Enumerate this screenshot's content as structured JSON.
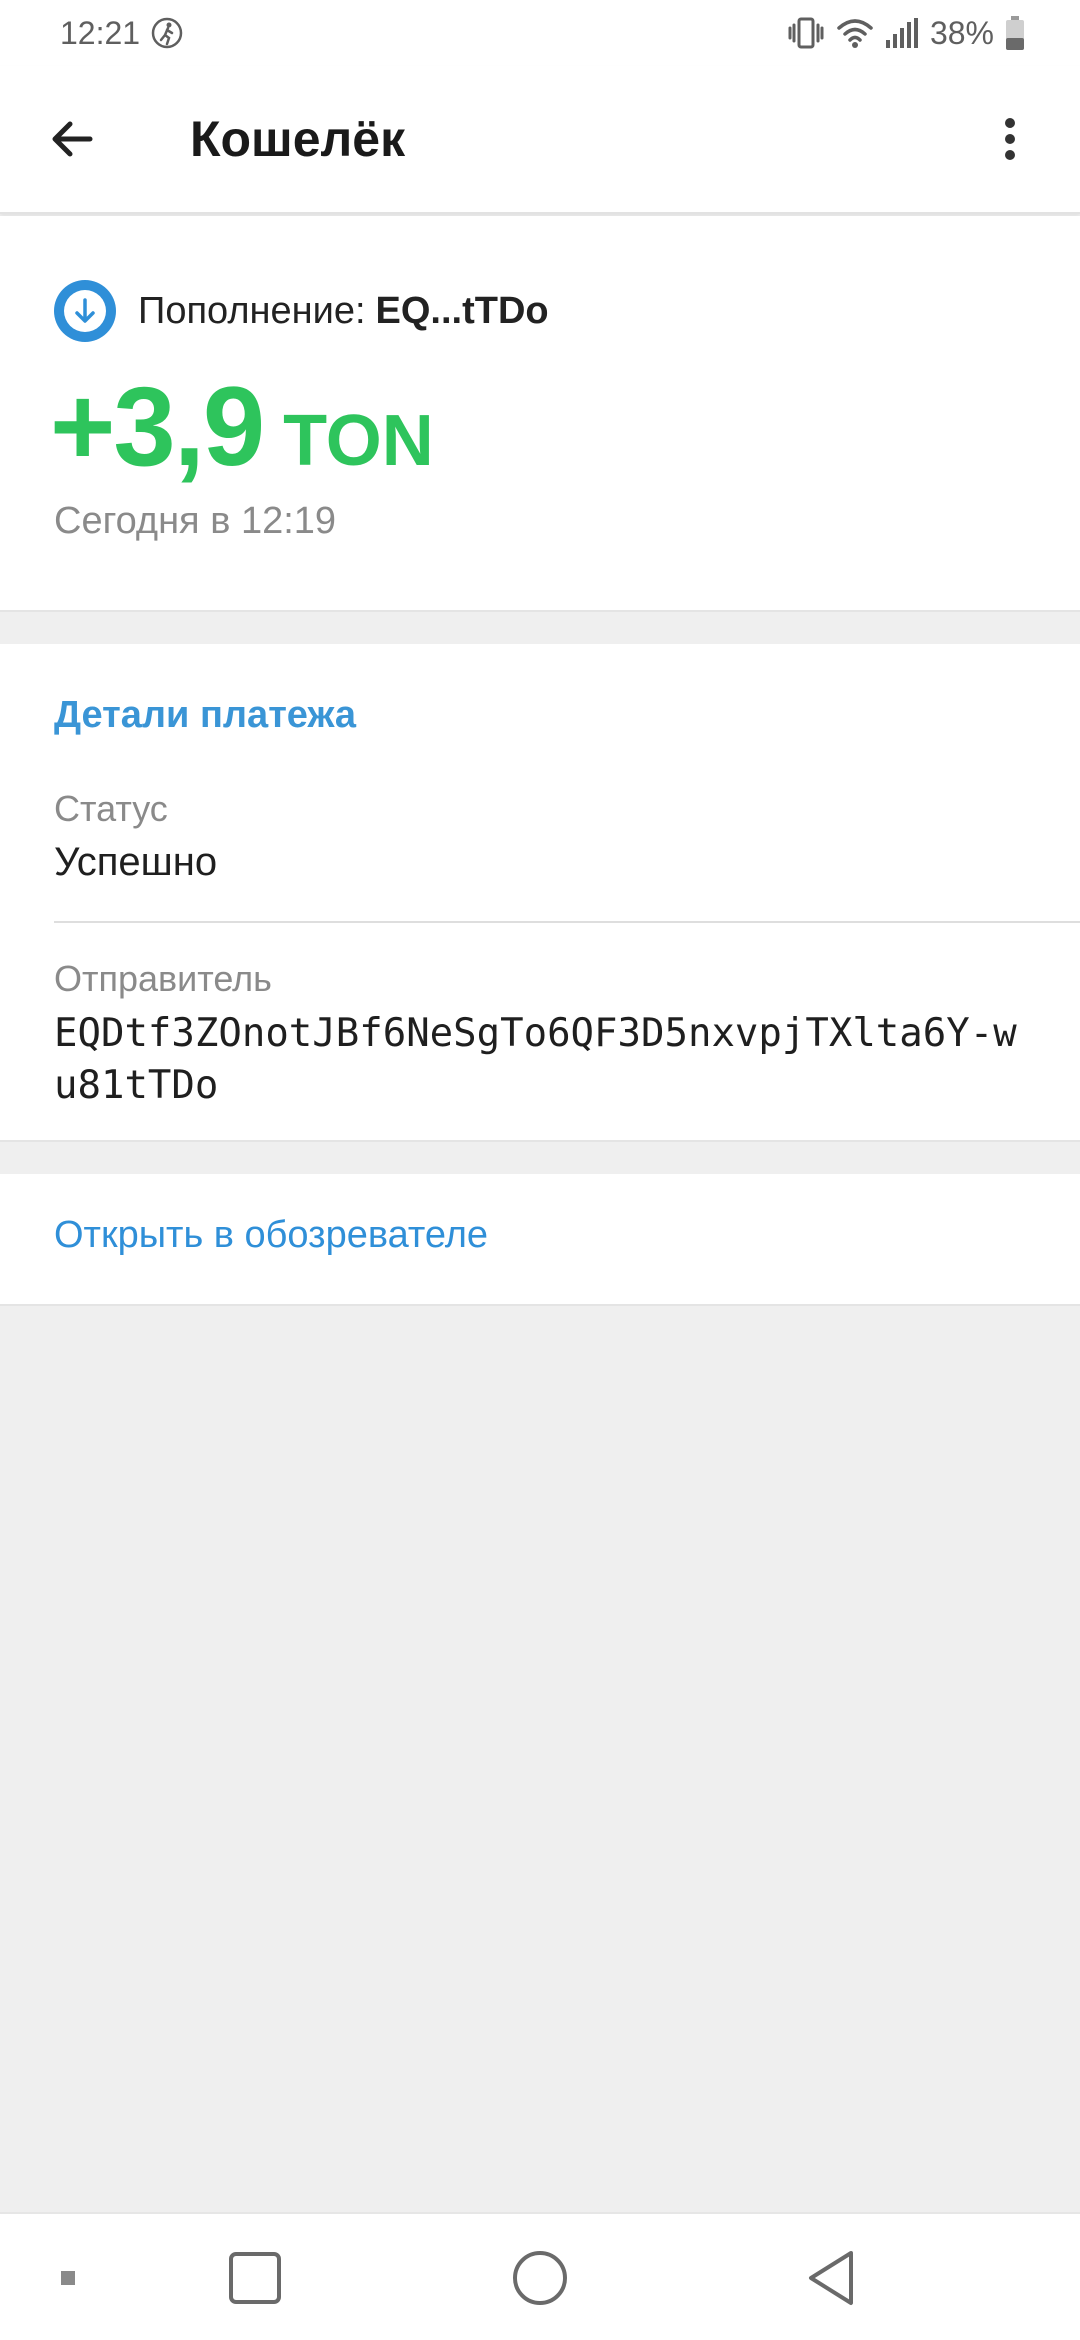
{
  "status_bar": {
    "time": "12:21",
    "battery": "38%"
  },
  "app_bar": {
    "title": "Кошелёк"
  },
  "transaction": {
    "label": "Пополнение:",
    "address_short": "EQ...tTDo",
    "amount": "+3,9",
    "currency": "TON",
    "date": "Сегодня в 12:19"
  },
  "details": {
    "heading": "Детали платежа",
    "status_label": "Статус",
    "status_value": "Успешно",
    "sender_label": "Отправитель",
    "sender_value": "EQDtf3ZOnotJBf6NeSgTo6QF3D5nxvpjTXlta6Y-wu81tTDo"
  },
  "explorer": {
    "link": "Открыть в обозревателе"
  },
  "colors": {
    "accent_blue": "#3a95d6",
    "amount_green": "#2ec45c",
    "background": "#efefef"
  }
}
